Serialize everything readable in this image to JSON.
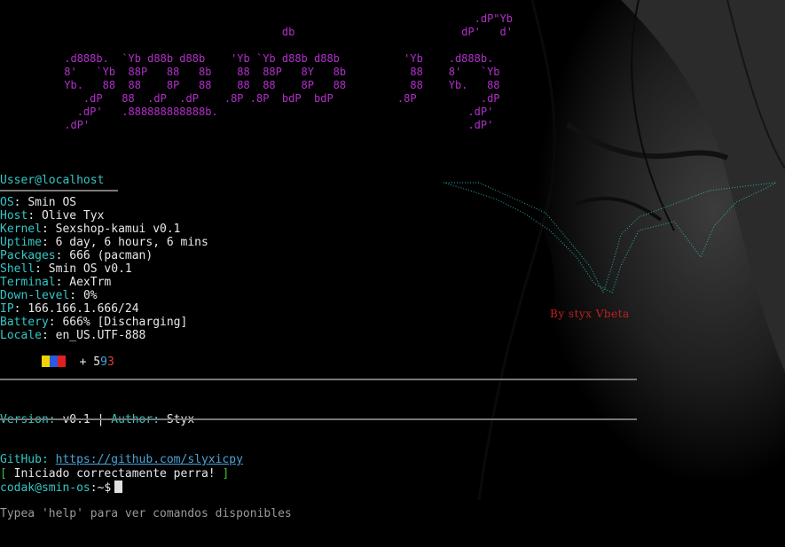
{
  "ascii_logo": [
    "                                                                          .dP\"Yb",
    "                                            db                          dP'   d'",
    "",
    "          .d888b.  `Yb d88b d88b    'Yb `Yb d88b d88b          'Yb    .d888b.",
    "          8'   `Yb  88P   88   8b    88  88P   8Y   8b          88    8'   `Yb",
    "          Yb.   88  88    8P   88    88  88    8P   88          88    Yb.   88",
    "             .dP   88  .dP  .dP    .8P .8P  bdP  bdP          .8P          .dP",
    "            .dP'   .888888888888b.                                       .dP'",
    "          .dP'                                                           .dP'"
  ],
  "user_host": "Usser@localhost",
  "info": [
    {
      "key": "OS",
      "value": "Smin OS"
    },
    {
      "key": "Host",
      "value": "Olive Tyx"
    },
    {
      "key": "Kernel",
      "value": "Sexshop-kamui v0.1"
    },
    {
      "key": "Uptime",
      "value": "6 day, 6 hours, 6 mins"
    },
    {
      "key": "Packages",
      "value": "666 (pacman)"
    },
    {
      "key": "Shell",
      "value": "Smin OS v0.1"
    },
    {
      "key": "Terminal",
      "value": "AexTrm"
    },
    {
      "key": "Down-level",
      "value": "0%"
    },
    {
      "key": "IP",
      "value": "166.166.1.666/24"
    },
    {
      "key": "Battery",
      "value": "666% [Discharging]"
    },
    {
      "key": "Locale",
      "value": "en_US.UTF-888"
    }
  ],
  "palette": {
    "colors": [
      "#f2d200",
      "#2a5ae0",
      "#e02020"
    ],
    "plus_text": "+",
    "digits": [
      "5",
      "9",
      "3"
    ]
  },
  "meta": {
    "version_label": "Version:",
    "version_value": "v0.1",
    "separator": "|",
    "author_label": "Author:",
    "author_value": "Styx",
    "github_label": "GitHub:",
    "github_url": "https://github.com/slyxicpy"
  },
  "messages": {
    "open_bracket": "[",
    "success_text": "Iniciado correctamente perra!",
    "close_bracket": "]",
    "help_hint": "Typea 'help' para ver comandos disponibles"
  },
  "prompt": {
    "user_host": "codak@smin-os",
    "path": ":~$"
  },
  "byline": "By styx Vbeta",
  "colors": {
    "ascii": "#b030c8",
    "key": "#35c6c6",
    "link": "#4aa3d8",
    "success_bracket": "#3fbf3f",
    "byline": "#c02020"
  }
}
